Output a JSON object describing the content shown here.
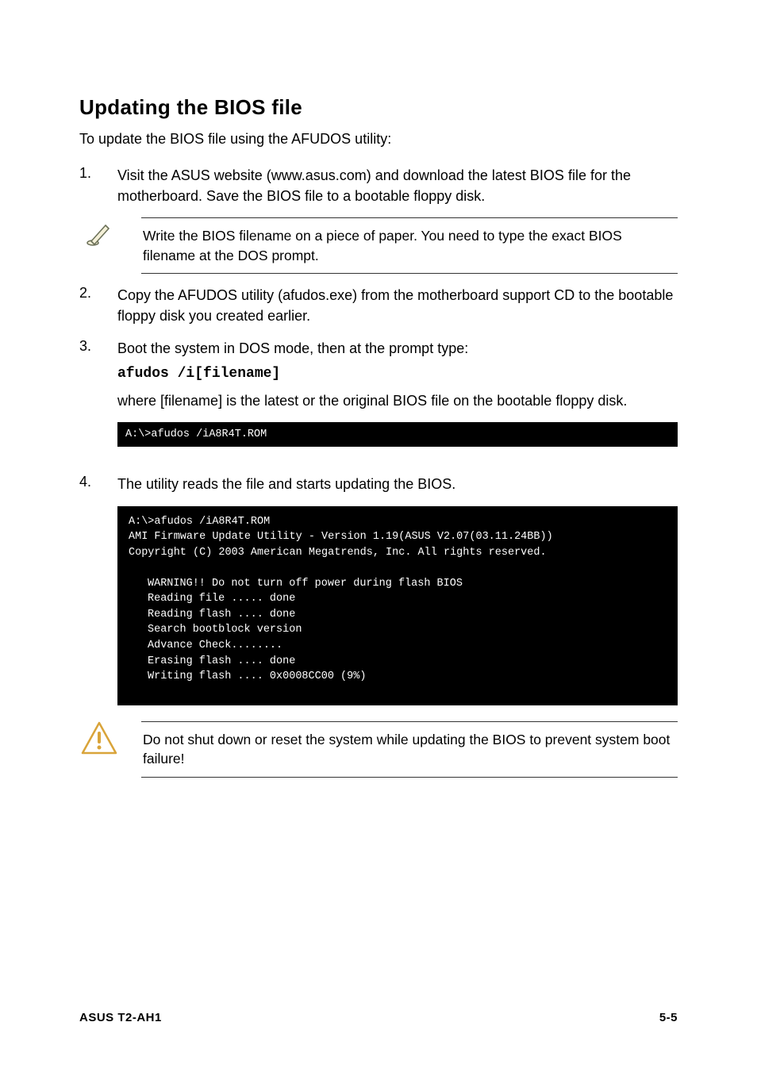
{
  "heading": "Updating the BIOS file",
  "intro": "To update the BIOS file using the AFUDOS utility:",
  "steps": {
    "s1_num": "1.",
    "s1_text": "Visit the ASUS website (www.asus.com) and download the latest BIOS file for the motherboard. Save the BIOS file to a bootable floppy disk.",
    "s2_num": "2.",
    "s2_text": "Copy the AFUDOS utility (afudos.exe) from the motherboard support CD to the bootable floppy disk you created earlier.",
    "s3_num": "3.",
    "s3_text": "Boot the system in DOS mode, then at the prompt type:",
    "s3_code": "afudos /i[filename]",
    "s3_after": "where [filename] is the latest or the original BIOS file on the bootable floppy disk.",
    "s4_num": "4.",
    "s4_text": "The utility reads the file and starts updating the BIOS."
  },
  "note1": "Write the BIOS filename on a piece of paper. You need to type the exact BIOS filename at the DOS prompt.",
  "warning1": "Do not shut down or reset the system while updating the BIOS to prevent system boot failure!",
  "terminal1": "A:\\>afudos /iA8R4T.ROM",
  "terminal2": {
    "l1": "A:\\>afudos /iA8R4T.ROM",
    "l2": "AMI Firmware Update Utility - Version 1.19(ASUS V2.07(03.11.24BB))",
    "l3": "Copyright (C) 2003 American Megatrends, Inc. All rights reserved.",
    "l4": "WARNING!! Do not turn off power during flash BIOS",
    "l5": "Reading file ..... done",
    "l6": "Reading flash .... done",
    "l7": "Search bootblock version",
    "l8": "Advance Check........",
    "l9": "Erasing flash .... done",
    "l10": "Writing flash .... 0x0008CC00 (9%)"
  },
  "footer": {
    "left": "ASUS T2-AH1",
    "right": "5-5"
  }
}
